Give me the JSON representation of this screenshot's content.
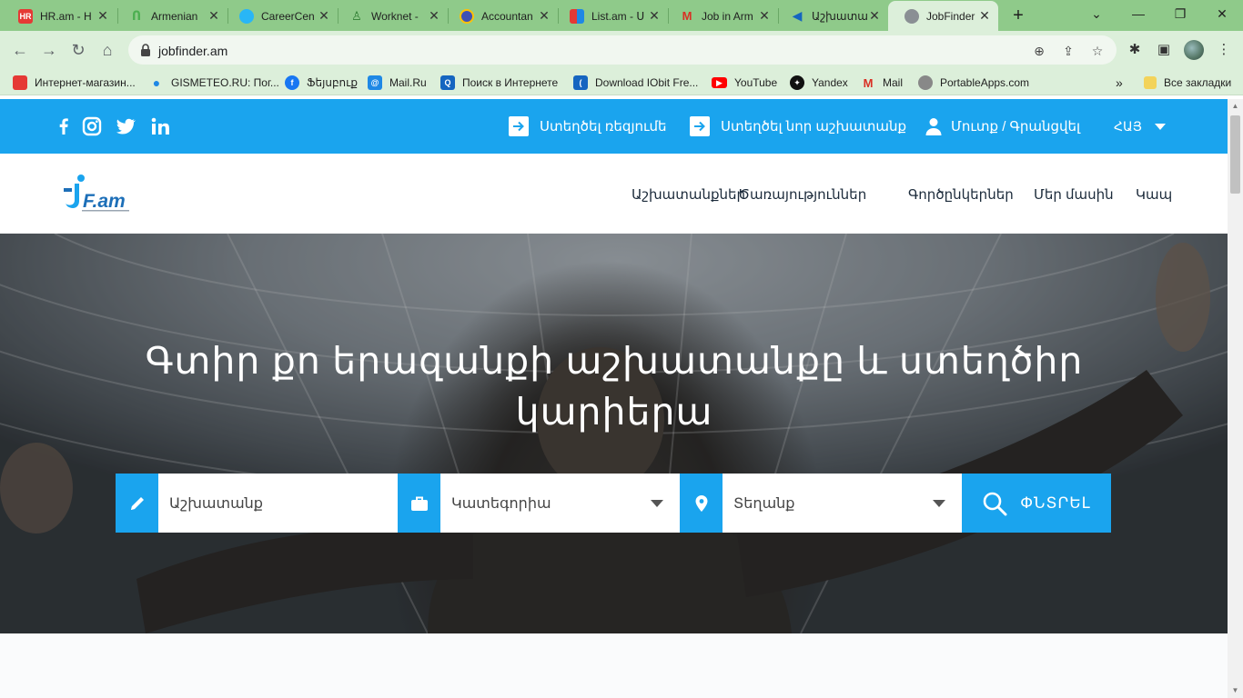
{
  "browser": {
    "tabs": [
      {
        "title": "HR.am - H",
        "icon": "hr-favicon",
        "color": "#e53935",
        "active": false
      },
      {
        "title": "Armenian",
        "icon": "armenian-favicon",
        "color": "#4caf50",
        "active": false
      },
      {
        "title": "CareerCen",
        "icon": "careercenter-favicon",
        "color": "#29b6f6",
        "active": false
      },
      {
        "title": "Worknet -",
        "icon": "worknet-favicon",
        "color": "#2e7d32",
        "active": false
      },
      {
        "title": "Accountan",
        "icon": "accountant-favicon",
        "color": "#3f51b5",
        "active": false
      },
      {
        "title": "List.am - Ս",
        "icon": "listam-favicon",
        "color": "#f4511e",
        "active": false
      },
      {
        "title": "Job in Arm",
        "icon": "gmail-favicon",
        "color": "#d93025",
        "active": false
      },
      {
        "title": "Աշխատա",
        "icon": "fish-favicon",
        "color": "#1565c0",
        "active": false
      },
      {
        "title": "JobFinder",
        "icon": "globe-favicon",
        "color": "#5f6368",
        "active": true
      }
    ],
    "url": "jobfinder.am",
    "bookmarks": [
      {
        "label": "Интернет-магазин...",
        "icon": "shop-icon",
        "color": "#e53935"
      },
      {
        "label": "GISMETEO.RU: Пог...",
        "icon": "weather-icon",
        "color": "#1e88e5"
      },
      {
        "label": "Ֆեյսբուք",
        "icon": "facebook-icon",
        "color": "#1877f2"
      },
      {
        "label": "Mail.Ru",
        "icon": "mailru-icon",
        "color": "#1e88e5"
      },
      {
        "label": "Поиск в Интернете",
        "icon": "search-icon",
        "color": "#1565c0"
      },
      {
        "label": "Download IObit Fre...",
        "icon": "iobit-icon",
        "color": "#1565c0"
      },
      {
        "label": "YouTube",
        "icon": "youtube-icon",
        "color": "#ff0000"
      },
      {
        "label": "Yandex",
        "icon": "yandex-icon",
        "color": "#111111"
      },
      {
        "label": "Mail",
        "icon": "gmail-icon",
        "color": "#d93025"
      },
      {
        "label": "PortableApps.com",
        "icon": "portableapps-icon",
        "color": "#777777"
      }
    ],
    "all_bookmarks": "Все закладки"
  },
  "topbar": {
    "post_resume": "Ստեղծել ռեզյումե",
    "post_job": "Ստեղծել նոր աշխատանք",
    "login": "Մուտք / Գրանցվել",
    "language": "ՀԱՅ"
  },
  "nav": {
    "logo_text": "F.am",
    "items": [
      "Աշխատանքներ",
      "Ծառայություններ",
      "Գործընկերներ",
      "Մեր մասին",
      "Կապ"
    ]
  },
  "hero": {
    "title": "Գտիր քո երազանքի աշխատանքը և ստեղծիր կարիերա"
  },
  "search": {
    "job_placeholder": "Աշխատանք",
    "category_placeholder": "Կատեգորիա",
    "location_placeholder": "Տեղանք",
    "button": "ՓՆՏՐԵԼ"
  },
  "colors": {
    "accent": "#1aa4ee",
    "tabstrip": "#8fca8a",
    "toolbar": "#dcefda"
  }
}
